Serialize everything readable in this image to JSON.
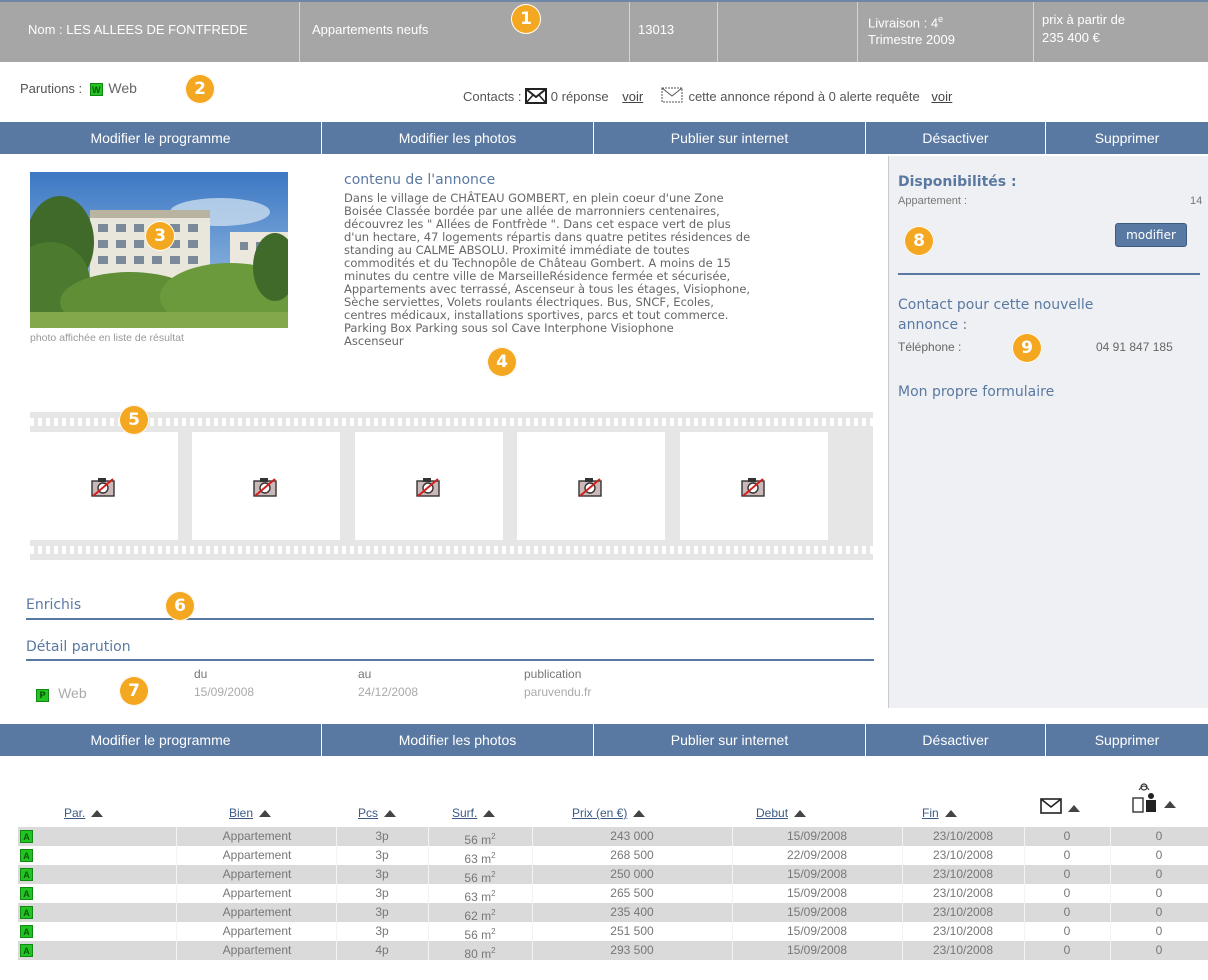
{
  "header": {
    "nom": "Nom : LES ALLEES DE FONTFREDE",
    "type": "Appartements neufs",
    "code": "13013",
    "livraison_line1": "Livraison : 4",
    "livraison_sup": "e",
    "livraison_line2": "Trimestre 2009",
    "prix_line1": "prix à partir de",
    "prix_line2": "235 400 €"
  },
  "parutions": {
    "label": "Parutions :",
    "badge": "W",
    "web": "Web"
  },
  "contacts": {
    "label": "Contacts :",
    "reponses": "0 réponse",
    "voir1": "voir",
    "alerte": "cette annonce répond à 0 alerte requête",
    "voir2": "voir"
  },
  "actions": [
    "Modifier le programme",
    "Modifier les photos",
    "Publier sur internet",
    "Désactiver",
    "Supprimer"
  ],
  "photo": {
    "caption": "photo affichée en liste de résultat"
  },
  "annonce": {
    "title": "contenu de l'annonce",
    "lines": [
      "Dans le village de CHÂTEAU GOMBERT, en plein coeur d'une Zone",
      "Boisée Classée bordée par une allée de marronniers centenaires,",
      "découvrez les \" Allées de Fontfrède \". Dans cet espace vert de plus",
      "d'un hectare, 47 logements répartis dans quatre petites résidences de",
      "standing au CALME ABSOLU. Proximité immédiate de toutes",
      "commodités et du Technopôle de Château Gombert. A moins de 15",
      "minutes du centre ville de MarseilleRésidence fermée et sécurisée,",
      "Appartements avec terrassé, Ascenseur à tous les étages, Visiophone,",
      "Sèche serviettes, Volets roulants électriques. Bus, SNCF, Ecoles,",
      "centres médicaux, installations sportives, parcs et tout commerce.",
      "Parking Box Parking sous sol Cave Interphone Visiophone",
      "Ascenseur"
    ]
  },
  "right": {
    "dispo_title": "Disponibilités :",
    "dispo_label": "Appartement :",
    "dispo_count": "14",
    "modifier": "modifier",
    "contact_title_1": "Contact pour cette nouvelle",
    "contact_title_2": "annonce :",
    "tel_label": "Téléphone :",
    "tel_value": "04 91 847 185",
    "formulaire": "Mon propre formulaire"
  },
  "sections": {
    "enrichis": "Enrichis",
    "detail": "Détail parution"
  },
  "detail": {
    "badge": "P",
    "web": "Web",
    "du_label": "du",
    "du_value": "15/09/2008",
    "au_label": "au",
    "au_value": "24/12/2008",
    "pub_label": "publication",
    "pub_value": "paruvendu.fr"
  },
  "markers": [
    "1",
    "2",
    "3",
    "4",
    "5",
    "6",
    "7",
    "8",
    "9"
  ],
  "table": {
    "headers": [
      "Par.",
      "Bien",
      "Pcs",
      "Surf.",
      "Prix (en €)",
      "Debut",
      "Fin"
    ],
    "rows": [
      {
        "par": "A",
        "bien": "Appartement",
        "pcs": "3p",
        "surf": "56 m",
        "prix": "243 000",
        "debut": "15/09/2008",
        "fin": "23/10/2008",
        "msg": "0",
        "alert": "0"
      },
      {
        "par": "A",
        "bien": "Appartement",
        "pcs": "3p",
        "surf": "63 m",
        "prix": "268 500",
        "debut": "22/09/2008",
        "fin": "23/10/2008",
        "msg": "0",
        "alert": "0"
      },
      {
        "par": "A",
        "bien": "Appartement",
        "pcs": "3p",
        "surf": "56 m",
        "prix": "250 000",
        "debut": "15/09/2008",
        "fin": "23/10/2008",
        "msg": "0",
        "alert": "0"
      },
      {
        "par": "A",
        "bien": "Appartement",
        "pcs": "3p",
        "surf": "63 m",
        "prix": "265 500",
        "debut": "15/09/2008",
        "fin": "23/10/2008",
        "msg": "0",
        "alert": "0"
      },
      {
        "par": "A",
        "bien": "Appartement",
        "pcs": "3p",
        "surf": "62 m",
        "prix": "235 400",
        "debut": "15/09/2008",
        "fin": "23/10/2008",
        "msg": "0",
        "alert": "0"
      },
      {
        "par": "A",
        "bien": "Appartement",
        "pcs": "3p",
        "surf": "56 m",
        "prix": "251 500",
        "debut": "15/09/2008",
        "fin": "23/10/2008",
        "msg": "0",
        "alert": "0"
      },
      {
        "par": "A",
        "bien": "Appartement",
        "pcs": "4p",
        "surf": "80 m",
        "prix": "293 500",
        "debut": "15/09/2008",
        "fin": "23/10/2008",
        "msg": "0",
        "alert": "0"
      }
    ],
    "sup": "2"
  },
  "colors": {
    "accent": "#5a79a2",
    "header_bg": "#a6a6a6",
    "marker": "#f4a720",
    "badge_green": "#22c322"
  },
  "icons": [
    "envelope-icon",
    "envelope-outline-icon",
    "no-photo-icon",
    "alert-person-icon",
    "sort-up-icon"
  ]
}
